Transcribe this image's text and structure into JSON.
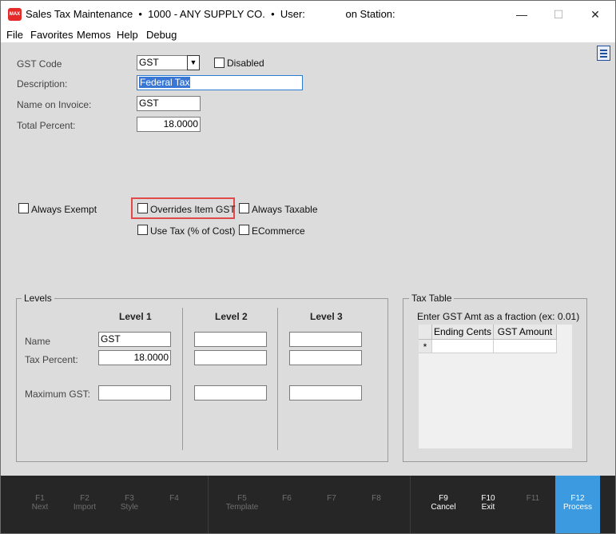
{
  "title": {
    "icon_text": "MAX",
    "text": "Sales Tax Maintenance  •  1000 - ANY SUPPLY CO.  •  User:              on Station:",
    "minimize": "—",
    "maximize": "☐",
    "close": "✕"
  },
  "menu": [
    "File",
    "Favorites",
    "Memos",
    "Help",
    "Debug"
  ],
  "form": {
    "gst_code_label": "GST Code",
    "gst_code_value": "GST",
    "disabled_label": "Disabled",
    "description_label": "Description:",
    "description_value": "Federal Tax",
    "name_on_invoice_label": "Name on Invoice:",
    "name_on_invoice_value": "GST",
    "total_percent_label": "Total Percent:",
    "total_percent_value": "18.0000"
  },
  "options": {
    "always_exempt": "Always Exempt",
    "overrides_item_gst": "Overrides Item GST",
    "always_taxable": "Always Taxable",
    "use_tax": "Use Tax (% of Cost)",
    "ecommerce": "ECommerce"
  },
  "levels": {
    "title": "Levels",
    "headers": [
      "Level 1",
      "Level 2",
      "Level 3"
    ],
    "name_label": "Name",
    "tax_percent_label": "Tax Percent:",
    "max_gst_label": "Maximum GST:",
    "level1_name": "GST",
    "level1_tax_percent": "18.0000"
  },
  "tax_table": {
    "title": "Tax Table",
    "hint": "Enter GST Amt as a fraction (ex: 0.01)",
    "columns": [
      "Ending Cents",
      "GST Amount"
    ],
    "new_row_marker": "*"
  },
  "fkeys": [
    {
      "key": "F1",
      "label": "Next"
    },
    {
      "key": "F2",
      "label": "Import"
    },
    {
      "key": "F3",
      "label": "Style"
    },
    {
      "key": "F4",
      "label": ""
    },
    {
      "key": "F5",
      "label": "Template"
    },
    {
      "key": "F6",
      "label": ""
    },
    {
      "key": "F7",
      "label": ""
    },
    {
      "key": "F8",
      "label": ""
    },
    {
      "key": "F9",
      "label": "Cancel"
    },
    {
      "key": "F10",
      "label": "Exit"
    },
    {
      "key": "F11",
      "label": ""
    },
    {
      "key": "F12",
      "label": "Process"
    }
  ],
  "colors": {
    "accent": "#3b9ae0",
    "highlight": "#e04a4a",
    "fbar": "#262626",
    "form_bg": "#dcdcdc"
  }
}
